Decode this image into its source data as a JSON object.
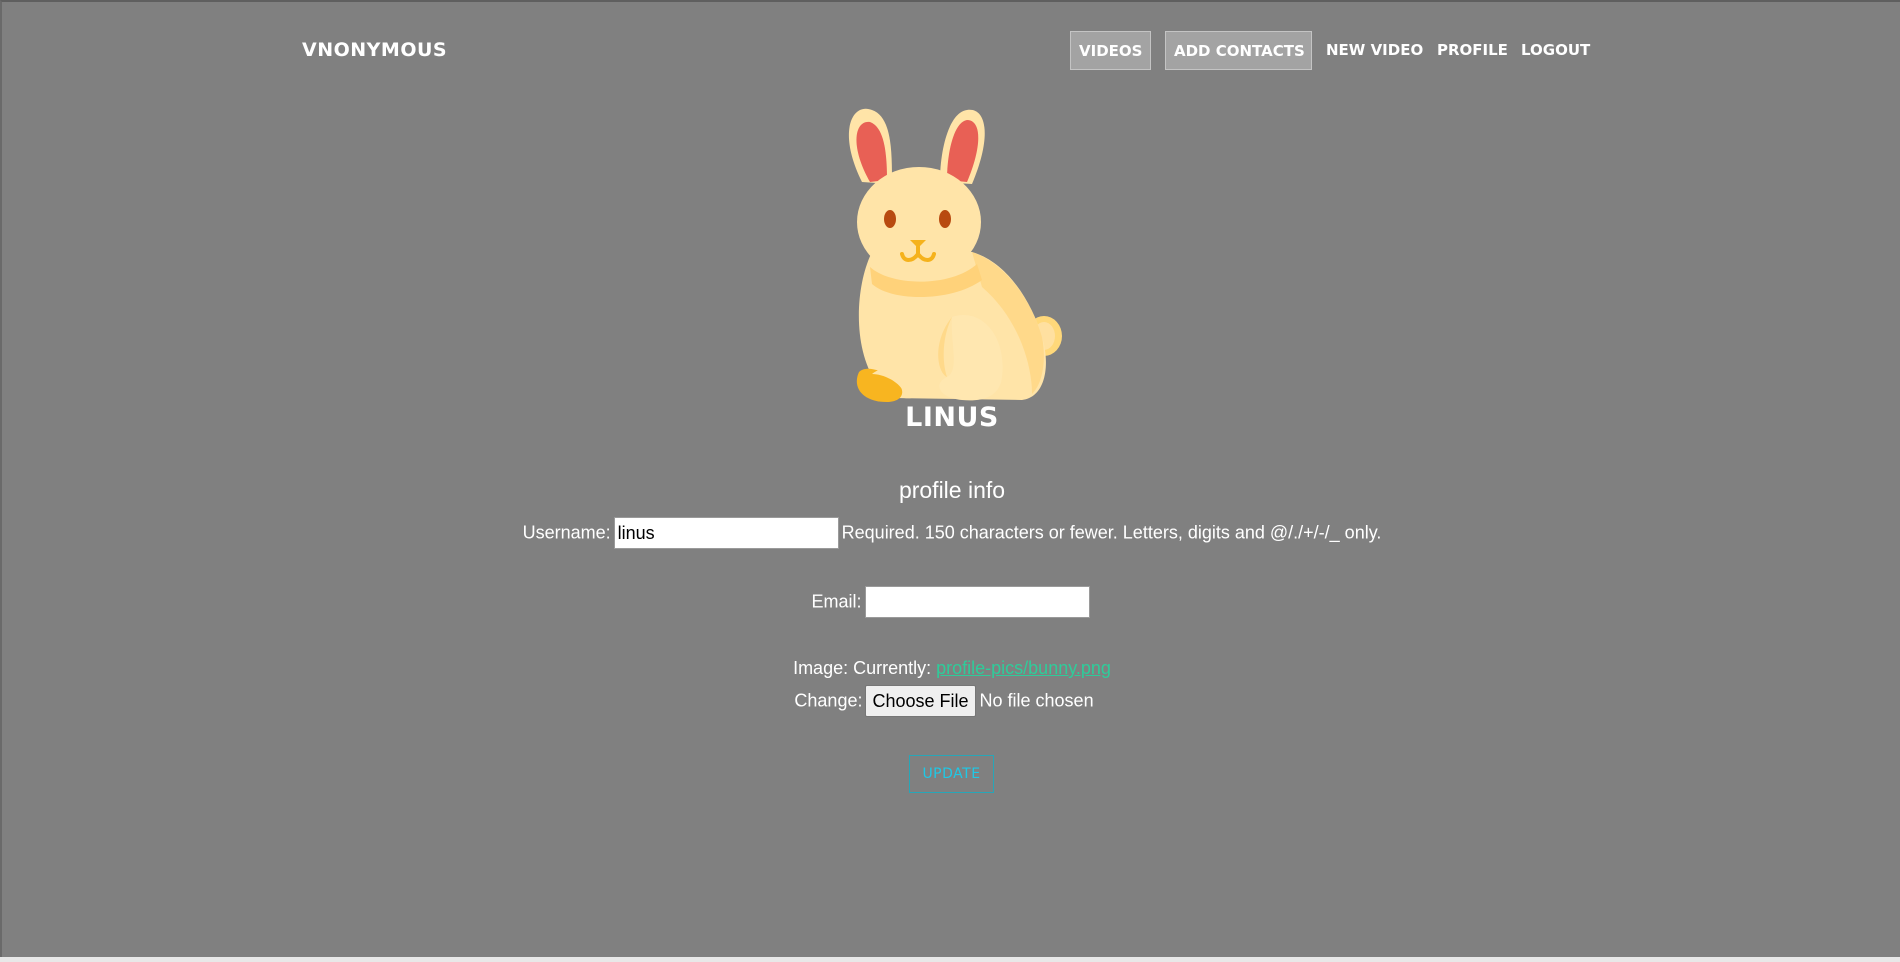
{
  "nav": {
    "brand": "VNONYMOUS",
    "links": [
      {
        "label": "VIDEOS",
        "boxed": true
      },
      {
        "label": "ADD CONTACTS",
        "boxed": true
      },
      {
        "label": "NEW VIDEO",
        "boxed": false
      },
      {
        "label": "PROFILE",
        "boxed": false
      },
      {
        "label": "LOGOUT",
        "boxed": false
      }
    ]
  },
  "profile": {
    "name": "LINUS",
    "avatar_icon": "bunny-icon"
  },
  "form": {
    "section_title": "profile info",
    "username_label": "Username:",
    "username_value": "linus",
    "username_help": "Required. 150 characters or fewer. Letters, digits and @/./+/-/_ only.",
    "email_label": "Email:",
    "email_value": "",
    "image_label": "Image: Currently:",
    "image_current": "profile-pics/bunny.png",
    "change_label": "Change:",
    "choose_file_label": "Choose File",
    "no_file_text": "No file chosen",
    "update_label": "UPDATE"
  },
  "colors": {
    "background": "#808080",
    "link": "#2ecc9a",
    "update_accent": "#1ec8e6"
  }
}
